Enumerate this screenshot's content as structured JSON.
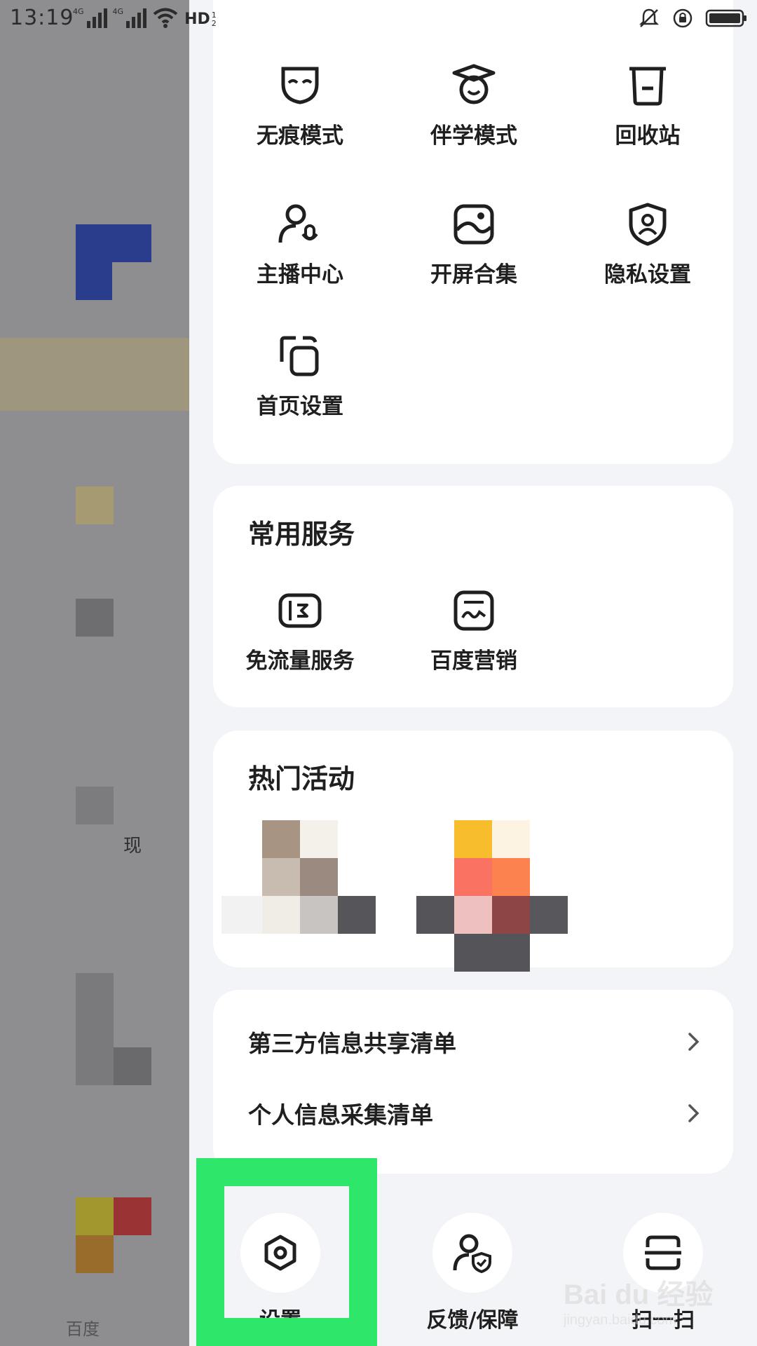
{
  "status_bar": {
    "time": "13:19",
    "network_1": "4G",
    "network_2": "4G",
    "hd_label": "HD",
    "icons": [
      "mute-icon",
      "rotation-lock-icon",
      "battery-icon"
    ]
  },
  "background_app": {
    "partial_text_1": "现",
    "partial_text_2": "百度"
  },
  "tools": [
    {
      "label": "无痕模式",
      "icon": "mask-icon"
    },
    {
      "label": "伴学模式",
      "icon": "graduation-cap-icon"
    },
    {
      "label": "回收站",
      "icon": "trash-icon"
    },
    {
      "label": "主播中心",
      "icon": "anchor-user-mic-icon"
    },
    {
      "label": "开屏合集",
      "icon": "image-gallery-icon"
    },
    {
      "label": "隐私设置",
      "icon": "privacy-shield-icon"
    },
    {
      "label": "首页设置",
      "icon": "home-layout-icon"
    }
  ],
  "services": {
    "title": "常用服务",
    "items": [
      {
        "label": "免流量服务",
        "icon": "data-free-icon"
      },
      {
        "label": "百度营销",
        "icon": "marketing-icon"
      }
    ]
  },
  "events": {
    "title": "热门活动"
  },
  "lists": [
    {
      "label": "第三方信息共享清单"
    },
    {
      "label": "个人信息采集清单"
    }
  ],
  "dock": [
    {
      "label": "设置",
      "icon": "settings-hexagon-icon"
    },
    {
      "label": "反馈/保障",
      "icon": "feedback-shield-icon"
    },
    {
      "label": "扫一扫",
      "icon": "scan-icon"
    }
  ],
  "watermark": {
    "main": "Bai du 经验",
    "sub": "jingyan.baidu.com"
  },
  "colors": {
    "highlight": "#2ee66a",
    "drawer_bg": "#f3f4f7",
    "card_bg": "#ffffff",
    "text": "#1f1f1f"
  }
}
